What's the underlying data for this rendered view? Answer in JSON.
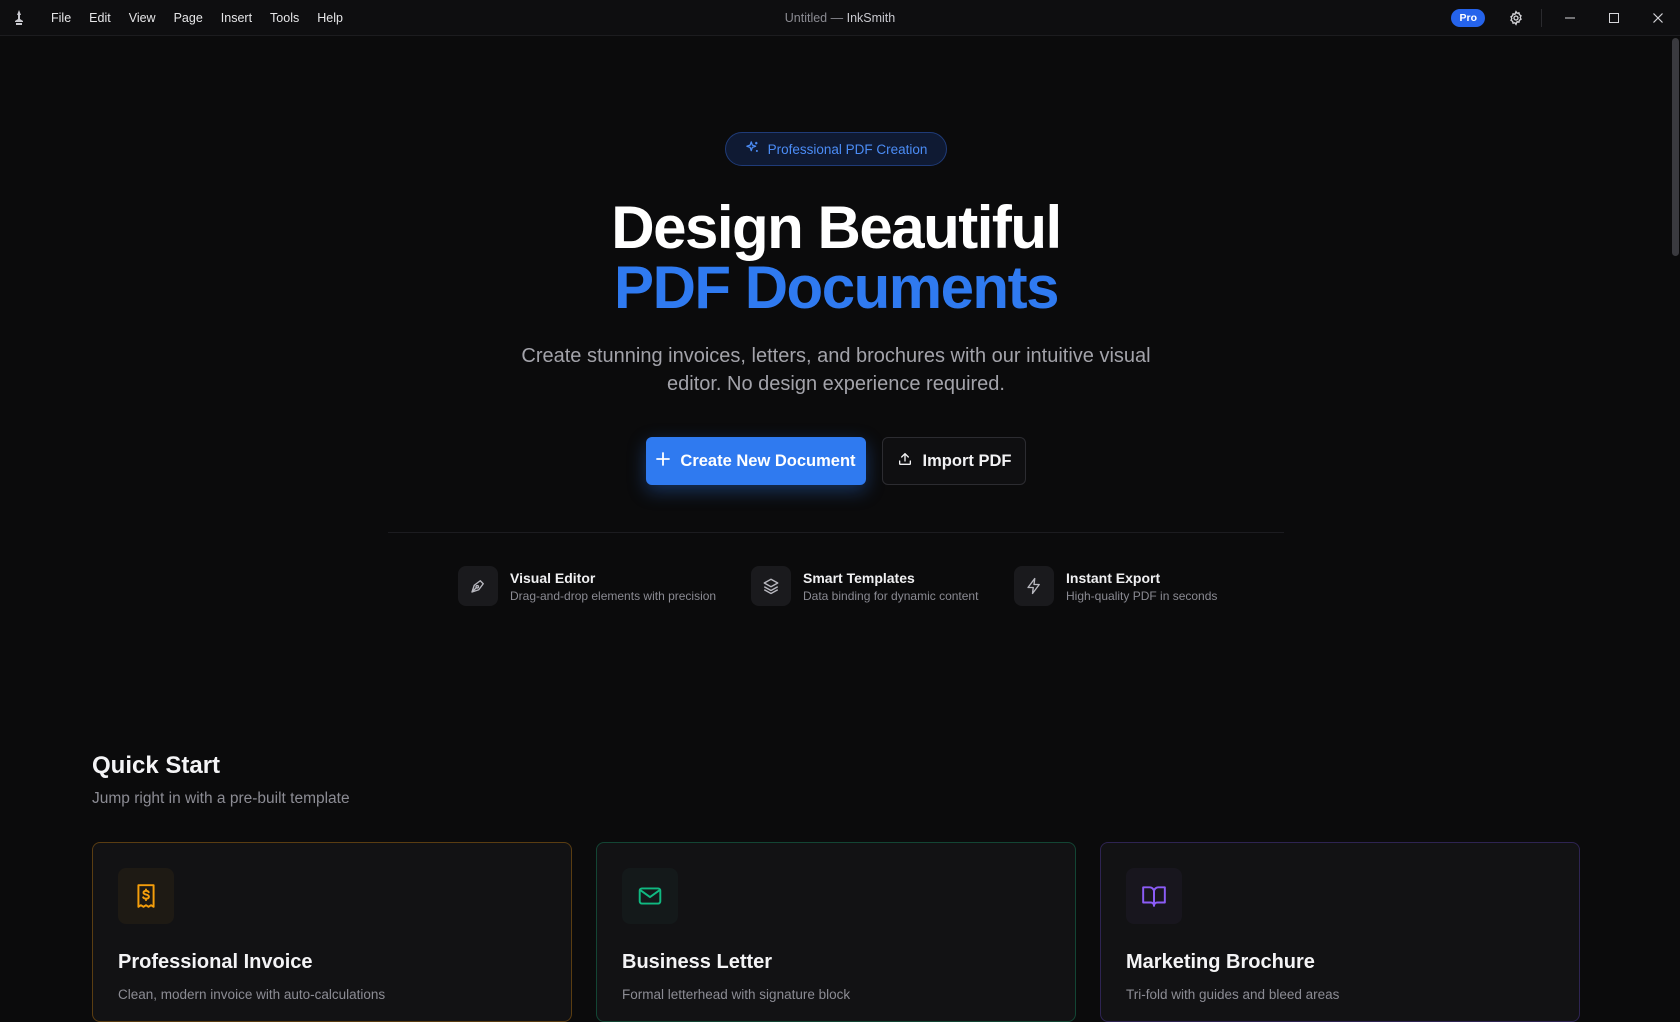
{
  "titlebar": {
    "menu": [
      "File",
      "Edit",
      "View",
      "Page",
      "Insert",
      "Tools",
      "Help"
    ],
    "document_name": "Untitled",
    "separator": " — ",
    "app_name": "InkSmith",
    "pro_label": "Pro"
  },
  "hero": {
    "pill": "Professional PDF Creation",
    "title_line1": "Design Beautiful",
    "title_line2": "PDF Documents",
    "subtitle": "Create stunning invoices, letters, and brochures with our intuitive visual editor. No design experience required.",
    "primary_button": "Create New Document",
    "secondary_button": "Import PDF"
  },
  "features": [
    {
      "title": "Visual Editor",
      "desc": "Drag-and-drop elements with precision",
      "icon": "pen-tool-icon"
    },
    {
      "title": "Smart Templates",
      "desc": "Data binding for dynamic content",
      "icon": "layers-icon"
    },
    {
      "title": "Instant Export",
      "desc": "High-quality PDF in seconds",
      "icon": "lightning-icon"
    }
  ],
  "quick_start": {
    "title": "Quick Start",
    "subtitle": "Jump right in with a pre-built template",
    "cards": [
      {
        "title": "Professional Invoice",
        "desc": "Clean, modern invoice with auto-calculations",
        "accent": "#f59e0b",
        "icon": "receipt-icon"
      },
      {
        "title": "Business Letter",
        "desc": "Formal letterhead with signature block",
        "accent": "#10b981",
        "icon": "mail-icon"
      },
      {
        "title": "Marketing Brochure",
        "desc": "Tri-fold with guides and bleed areas",
        "accent": "#8b5cf6",
        "icon": "book-open-icon"
      }
    ]
  },
  "colors": {
    "accent": "#2f7af0",
    "background": "#0b0b0c"
  }
}
